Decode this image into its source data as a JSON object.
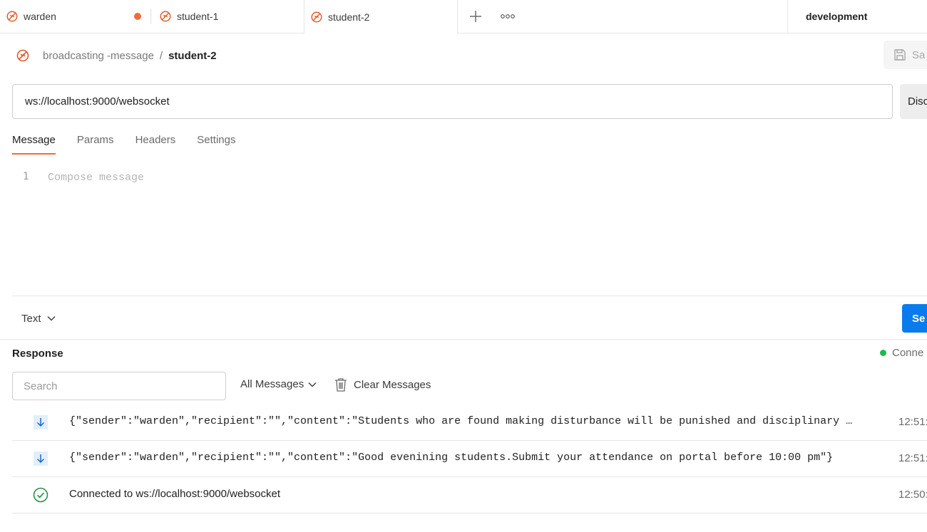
{
  "tabs": [
    {
      "label": "warden",
      "dirty": true
    },
    {
      "label": "student-1",
      "dirty": false
    },
    {
      "label": "student-2",
      "dirty": false,
      "active": true
    }
  ],
  "environment": "development",
  "breadcrumb": {
    "parent": "broadcasting -message",
    "separator": "/",
    "current": "student-2"
  },
  "save_label": "Sa",
  "url": "ws://localhost:9000/websocket",
  "disconnect_label": "Disc",
  "request_tabs": [
    "Message",
    "Params",
    "Headers",
    "Settings"
  ],
  "editor": {
    "line_number": "1",
    "placeholder": "Compose message"
  },
  "format": "Text",
  "send_label": "Se",
  "response": {
    "title": "Response",
    "status": "Conne",
    "search_placeholder": "Search",
    "filter": "All Messages",
    "clear_label": "Clear Messages",
    "messages": [
      {
        "type": "incoming",
        "text": "{\"sender\":\"warden\",\"recipient\":\"\",\"content\":\"Students who are found making disturbance will be punished and disciplinary …",
        "time": "12:51:"
      },
      {
        "type": "incoming",
        "text": "{\"sender\":\"warden\",\"recipient\":\"\",\"content\":\"Good evenining students.Submit your attendance on portal before 10:00 pm\"}",
        "time": "12:51:"
      },
      {
        "type": "connected",
        "text": "Connected to ws://localhost:9000/websocket",
        "time": "12:50:"
      }
    ]
  },
  "colors": {
    "accent": "#f26b3a",
    "primary": "#097bed",
    "connected": "#1db954"
  }
}
